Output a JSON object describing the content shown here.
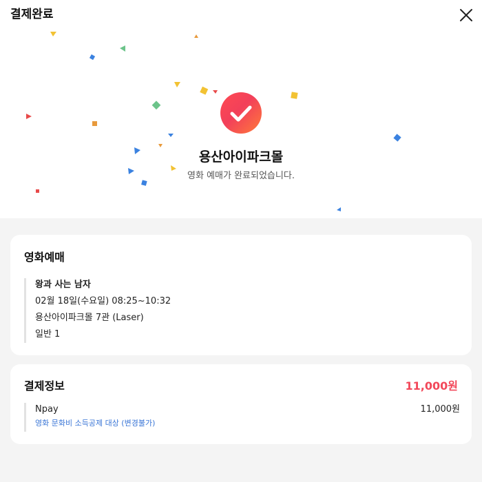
{
  "header": {
    "title": "결제완료",
    "close_icon": "close-icon"
  },
  "hero": {
    "theater": "용산아이파크몰",
    "message": "영화 예매가 완료되었습니다.",
    "check_icon": "check-circle-icon",
    "accent_gradient": [
      "#ff4a52",
      "#ff7a3a"
    ]
  },
  "movie_card": {
    "title": "영화예매",
    "movie_title": "왕과 사는 남자",
    "datetime": "02월 18일(수요일) 08:25~10:32",
    "location": "용산아이파크몰 7관 (Laser)",
    "audience": "일반 1"
  },
  "payment_card": {
    "title": "결제정보",
    "total": "11,000원",
    "method": "Npay",
    "method_amount": "11,000원",
    "note": "영화 문화비 소득공제 대상 (변경불가)",
    "total_color": "#f2485a",
    "note_color": "#3a76d6"
  }
}
